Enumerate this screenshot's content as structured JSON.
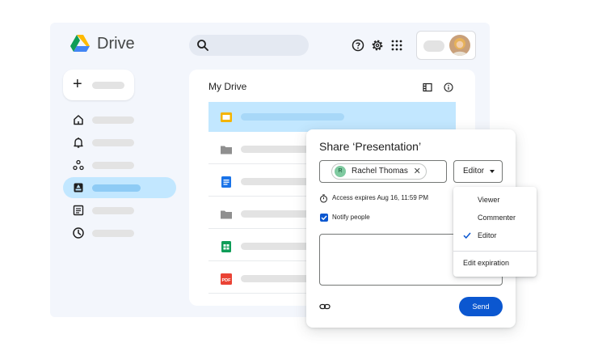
{
  "app": {
    "name": "Drive"
  },
  "panel": {
    "title": "My Drive"
  },
  "share": {
    "title": "Share ‘Presentation’",
    "recipient": {
      "name": "Rachel Thomas",
      "initial": "R"
    },
    "role": "Editor",
    "expiry": "Access expires Aug 16, 11:59 PM",
    "notify_label": "Notify people",
    "notify_checked": true,
    "send_label": "Send"
  },
  "role_menu": {
    "items": [
      "Viewer",
      "Commenter",
      "Editor"
    ],
    "selected": "Editor",
    "extra": "Edit expiration"
  },
  "files": [
    {
      "type": "slides-icon",
      "selected": true
    },
    {
      "type": "folder-icon"
    },
    {
      "type": "docs-icon"
    },
    {
      "type": "folder-icon"
    },
    {
      "type": "sheets-icon"
    },
    {
      "type": "pdf-icon"
    }
  ],
  "nav": [
    {
      "icon": "home-icon"
    },
    {
      "icon": "bell-icon"
    },
    {
      "icon": "shared-icon"
    },
    {
      "icon": "my-drive-icon",
      "active": true
    },
    {
      "icon": "computers-icon"
    },
    {
      "icon": "clock-icon"
    }
  ],
  "colors": {
    "accent": "#0b57d0",
    "selection": "#c2e7ff",
    "chip_avatar": "#7fcaa0"
  }
}
